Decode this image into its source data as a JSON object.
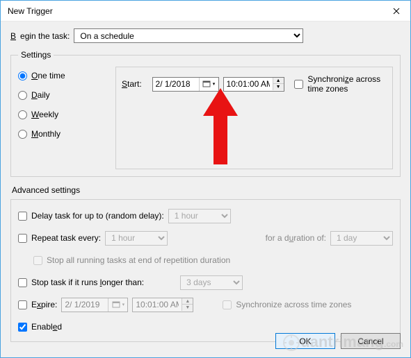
{
  "window": {
    "title": "New Trigger"
  },
  "begin": {
    "label_pre": "B",
    "label_rest": "egin the task:",
    "value": "On a schedule"
  },
  "settings": {
    "legend": "Settings",
    "radios": {
      "one_pre": "O",
      "one_rest": "ne time",
      "daily_pre": "D",
      "daily_rest": "aily",
      "weekly_pre": "W",
      "weekly_rest": "eekly",
      "monthly_pre": "M",
      "monthly_rest": "onthly"
    },
    "start_label_pre": "S",
    "start_label_rest": "tart:",
    "date": "2/ 1/2018",
    "time": "10:01:00 AM",
    "sync_pre": "Synchroni",
    "sync_u": "z",
    "sync_post": "e across time zones"
  },
  "advanced": {
    "title": "Advanced settings",
    "delay_label": "Delay task for up to (random delay):",
    "delay_value": "1 hour",
    "repeat_pre": "Repeat task every",
    "repeat_u": "",
    "repeat_post": ":",
    "repeat_value": "1 hour",
    "duration_pre": "for a d",
    "duration_u": "u",
    "duration_post": "ration of:",
    "duration_value": "1 day",
    "stop_all": "Stop all running tasks at end of repetition duration",
    "stop_if_pre": "Stop task if it runs ",
    "stop_if_u": "l",
    "stop_if_post": "onger than:",
    "stop_if_value": "3 days",
    "expire_pre": "E",
    "expire_u": "x",
    "expire_post": "pire:",
    "expire_date": "2/ 1/2019",
    "expire_time": "10:01:00 AM",
    "sync2": "Synchronize across time zones",
    "enabled_pre": "Enabl",
    "enabled_u": "e",
    "enabled_post": "d"
  },
  "footer": {
    "ok": "OK",
    "cancel": "Cancel"
  }
}
